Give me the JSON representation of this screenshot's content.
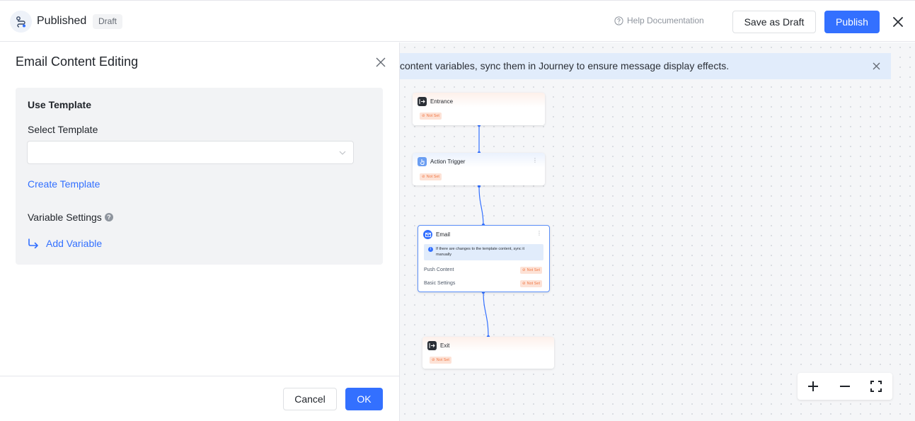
{
  "header": {
    "title": "Published",
    "badge": "Draft",
    "help_label": "Help Documentation",
    "save_draft_label": "Save as Draft",
    "publish_label": "Publish"
  },
  "notice": {
    "text": "content variables, sync them in Journey to ensure message display effects."
  },
  "canvas": {
    "nodes": {
      "entrance": {
        "label": "Entrance",
        "status": "Not Set"
      },
      "action_trigger": {
        "label": "Action Trigger",
        "status": "Not Set"
      },
      "email": {
        "label": "Email",
        "info": "If there are changes to the template content, sync it manually",
        "push_content_label": "Push Content",
        "push_content_status": "Not Set",
        "basic_settings_label": "Basic Settings",
        "basic_settings_status": "Not Set"
      },
      "exit": {
        "label": "Exit",
        "status": "Not Set"
      }
    }
  },
  "drawer": {
    "title": "Email Content Editing",
    "panel_title": "Use Template",
    "select_label": "Select Template",
    "select_value": "",
    "create_template_label": "Create Template",
    "variable_settings_label": "Variable Settings",
    "add_variable_label": "Add Variable",
    "cancel_label": "Cancel",
    "ok_label": "OK"
  },
  "colors": {
    "primary": "#3370ff",
    "not_set_bg": "#fde2d6",
    "not_set_text": "#f07845",
    "notice_bg": "#e1ecfb"
  }
}
